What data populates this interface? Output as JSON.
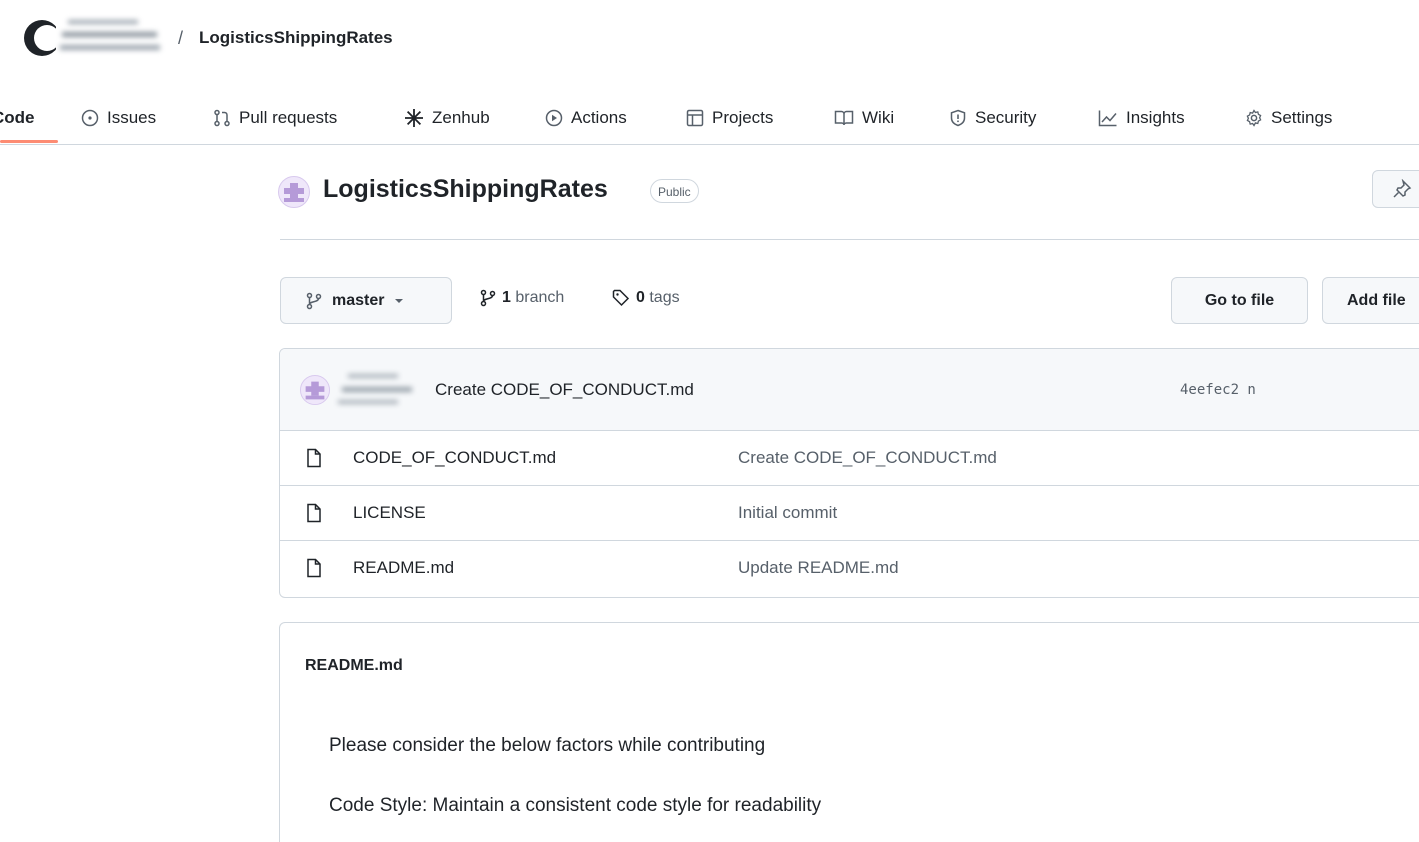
{
  "header": {
    "separator": "/",
    "repo_name": "LogisticsShippingRates"
  },
  "tabs": [
    {
      "label": "Code",
      "icon": "code-icon",
      "selected": true
    },
    {
      "label": "Issues",
      "icon": "issue-opened-icon"
    },
    {
      "label": "Pull requests",
      "icon": "git-pull-request-icon"
    },
    {
      "label": "Zenhub",
      "icon": "zenhub-icon"
    },
    {
      "label": "Actions",
      "icon": "play-icon"
    },
    {
      "label": "Projects",
      "icon": "table-icon"
    },
    {
      "label": "Wiki",
      "icon": "book-icon"
    },
    {
      "label": "Security",
      "icon": "shield-icon"
    },
    {
      "label": "Insights",
      "icon": "graph-icon"
    },
    {
      "label": "Settings",
      "icon": "gear-icon"
    }
  ],
  "repo": {
    "title": "LogisticsShippingRates",
    "visibility": "Public"
  },
  "branch": {
    "current": "master",
    "branch_count": "1",
    "branch_label": "branch",
    "tag_count": "0",
    "tag_label": "tags"
  },
  "actions": {
    "go_to_file": "Go to file",
    "add_file": "Add file"
  },
  "latest_commit": {
    "message": "Create CODE_OF_CONDUCT.md",
    "sha": "4eefec2 n"
  },
  "files": [
    {
      "name": "CODE_OF_CONDUCT.md",
      "commit": "Create CODE_OF_CONDUCT.md"
    },
    {
      "name": "LICENSE",
      "commit": "Initial commit"
    },
    {
      "name": "README.md",
      "commit": "Update README.md"
    }
  ],
  "readme": {
    "title": "README.md",
    "paragraphs": [
      "Please consider the below factors while contributing",
      "Code Style: Maintain a consistent code style for readability"
    ]
  },
  "colors": {
    "accent_underline": "#fd8c73",
    "border": "#d0d7de",
    "muted_text": "#57606a",
    "avatar_purple": "#b59ad8"
  }
}
